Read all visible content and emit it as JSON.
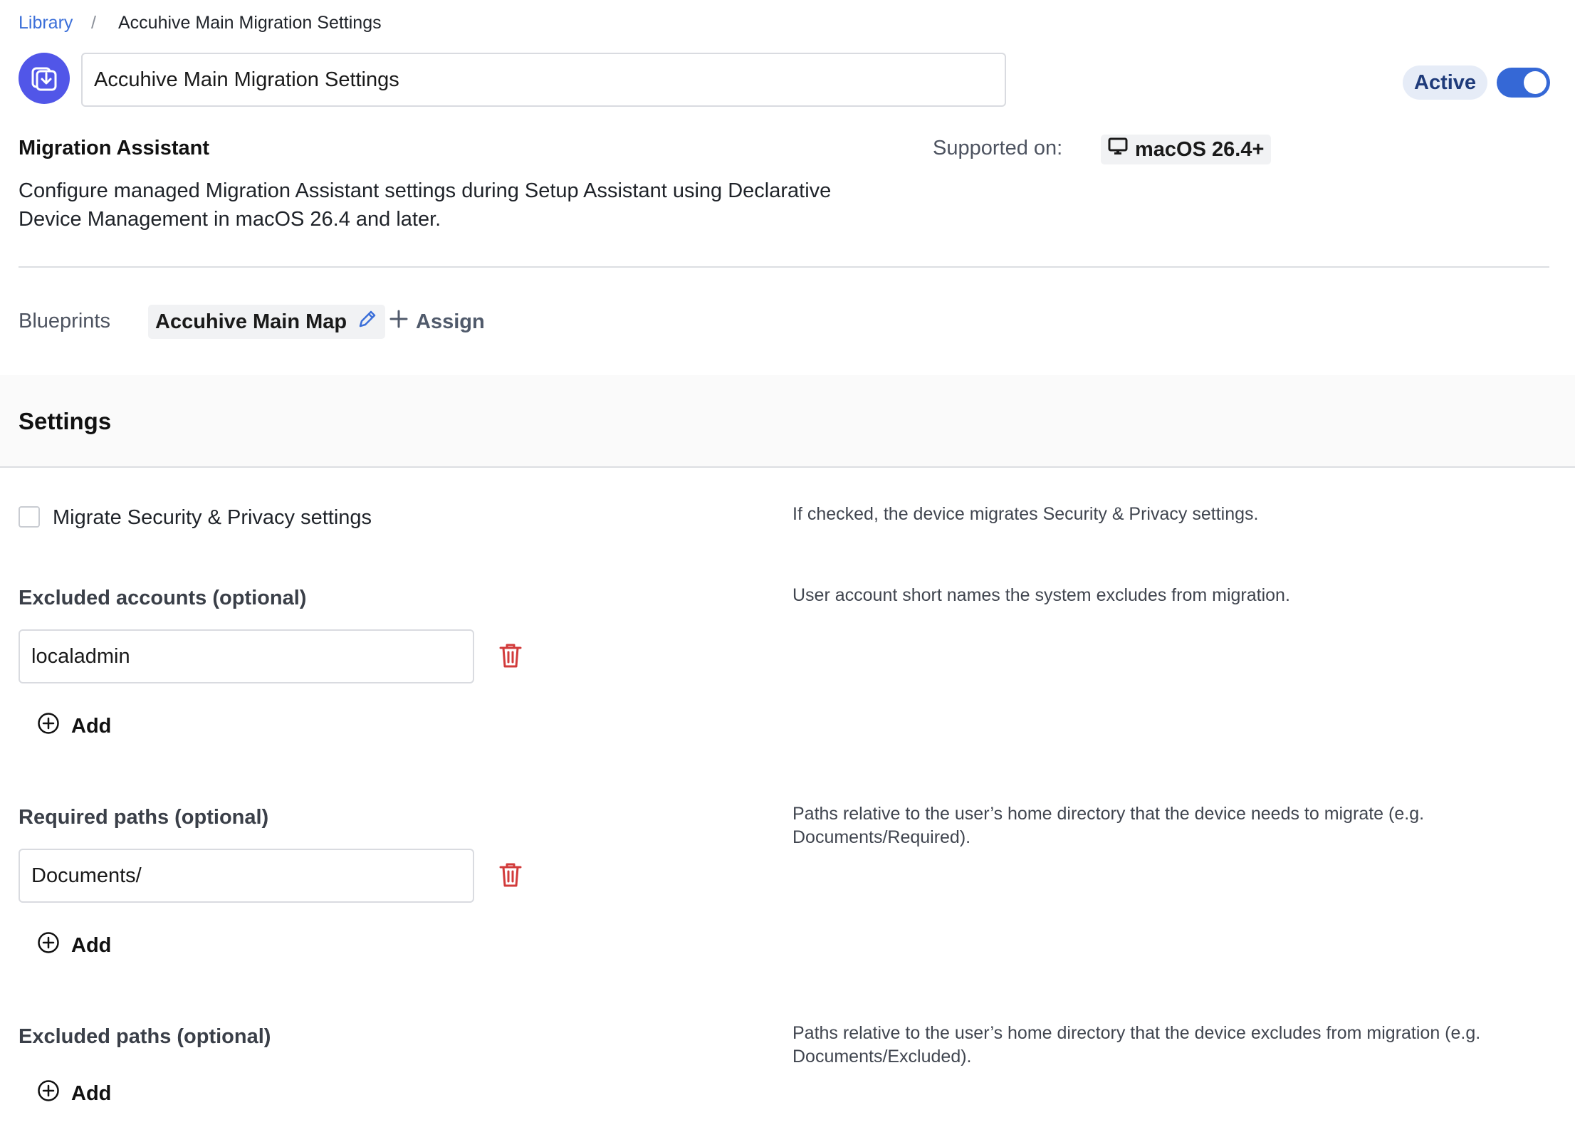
{
  "breadcrumb": {
    "library_label": "Library",
    "separator": "/",
    "current": "Accuhive Main Migration Settings"
  },
  "header": {
    "icon": "download-tray-icon",
    "title_value": "Accuhive Main Migration Settings",
    "status_label": "Active",
    "toggle_on": true
  },
  "item": {
    "name": "Migration Assistant",
    "description": "Configure managed Migration Assistant settings during Setup Assistant using Declarative Device Management in macOS 26.4 and later.",
    "supported_label": "Supported on:",
    "supported_os": "macOS 26.4+"
  },
  "blueprints": {
    "label": "Blueprints",
    "assigned": [
      "Accuhive Main Map"
    ],
    "assign_label": "Assign"
  },
  "settings": {
    "title": "Settings",
    "migrate_security": {
      "label": "Migrate Security & Privacy settings",
      "checked": false,
      "help": "If checked, the device migrates Security & Privacy settings."
    },
    "excluded_accounts": {
      "label": "Excluded accounts (optional)",
      "help": "User account short names the system excludes from migration.",
      "values": [
        "localadmin"
      ],
      "add_label": "Add"
    },
    "required_paths": {
      "label": "Required paths (optional)",
      "help": "Paths relative to the user’s home directory that the device needs to migrate (e.g. Documents/Required).",
      "values": [
        "Documents/"
      ],
      "add_label": "Add"
    },
    "excluded_paths": {
      "label": "Excluded paths (optional)",
      "help": "Paths relative to the user’s home directory that the device excludes from migration (e.g. Documents/Excluded).",
      "values": [],
      "add_label": "Add"
    }
  },
  "colors": {
    "accent": "#3568d6",
    "icon_bg": "#5156e8",
    "danger": "#d23b3b"
  }
}
